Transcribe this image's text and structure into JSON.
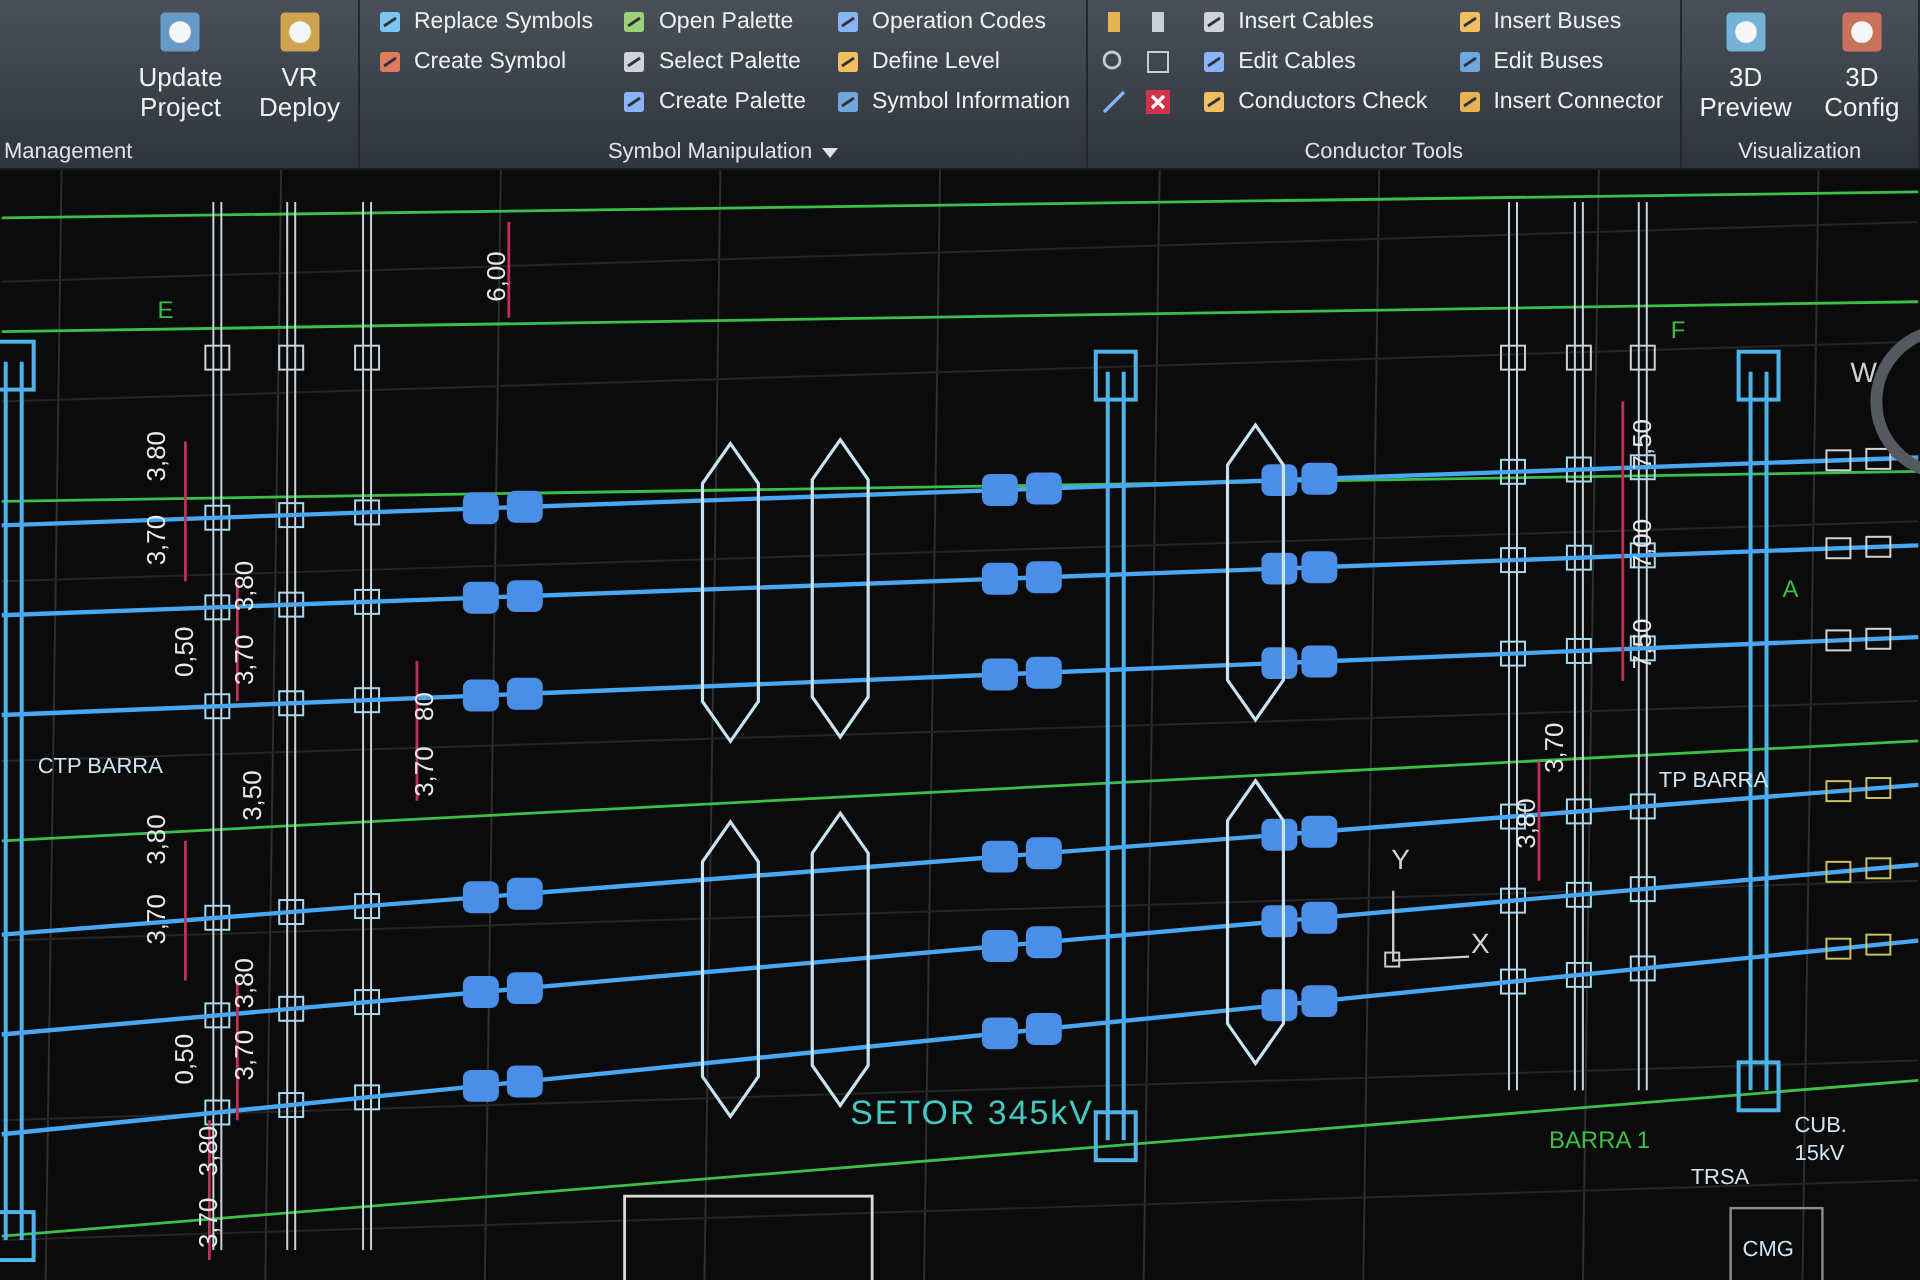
{
  "ribbon": {
    "groups": [
      {
        "kind": "large",
        "label": "Management",
        "items": [
          {
            "label": "Update Project"
          },
          {
            "label": "VR Deploy"
          }
        ]
      },
      {
        "kind": "columns",
        "label": "Symbol Manipulation",
        "dropdown": true,
        "columns": [
          [
            {
              "label": "Replace Symbols"
            },
            {
              "label": "Create Symbol"
            }
          ],
          [
            {
              "label": "Open Palette"
            },
            {
              "label": "Select Palette"
            },
            {
              "label": "Create Palette"
            }
          ],
          [
            {
              "label": "Operation Codes"
            },
            {
              "label": "Define Level"
            },
            {
              "label": "Symbol Information"
            }
          ]
        ]
      },
      {
        "kind": "columns",
        "label": "Conductor Tools",
        "columns": [
          [
            {
              "label": "Insert Cables"
            },
            {
              "label": "Edit Cables"
            },
            {
              "label": "Conductors Check"
            }
          ],
          [
            {
              "label": "Insert Buses"
            },
            {
              "label": "Edit Buses"
            },
            {
              "label": "Insert Connector"
            }
          ]
        ]
      },
      {
        "kind": "large",
        "label": "Visualization",
        "items": [
          {
            "label": "3D Preview"
          },
          {
            "label": "3D Config"
          }
        ]
      }
    ]
  },
  "drawing": {
    "labels": [
      {
        "text": "6,00",
        "kind": "dimension"
      },
      {
        "text": "E",
        "kind": "marker"
      },
      {
        "text": "F",
        "kind": "marker"
      },
      {
        "text": "3,80",
        "kind": "dimension"
      },
      {
        "text": "3,70",
        "kind": "dimension"
      },
      {
        "text": "0,50",
        "kind": "dimension"
      },
      {
        "text": "3,80",
        "kind": "dimension"
      },
      {
        "text": "3,70",
        "kind": "dimension"
      },
      {
        "text": "80",
        "kind": "dimension"
      },
      {
        "text": "3,70",
        "kind": "dimension"
      },
      {
        "text": "3,50",
        "kind": "dimension"
      },
      {
        "text": "CTP BARRA",
        "kind": "tag"
      },
      {
        "text": "3,80",
        "kind": "dimension"
      },
      {
        "text": "3,70",
        "kind": "dimension"
      },
      {
        "text": "0,50",
        "kind": "dimension"
      },
      {
        "text": "3,80",
        "kind": "dimension"
      },
      {
        "text": "3,70",
        "kind": "dimension"
      },
      {
        "text": "3,80",
        "kind": "dimension"
      },
      {
        "text": "3,70",
        "kind": "dimension"
      },
      {
        "text": "SETOR 345kV",
        "kind": "title"
      },
      {
        "text": "7,50",
        "kind": "dimension"
      },
      {
        "text": "7,00",
        "kind": "dimension"
      },
      {
        "text": "7,50",
        "kind": "dimension"
      },
      {
        "text": "TP BARRA",
        "kind": "tag"
      },
      {
        "text": "3,80",
        "kind": "dimension"
      },
      {
        "text": "3,70",
        "kind": "dimension"
      },
      {
        "text": "Y",
        "kind": "axis"
      },
      {
        "text": "X",
        "kind": "axis"
      },
      {
        "text": "A",
        "kind": "marker"
      },
      {
        "text": "W",
        "kind": "axis"
      },
      {
        "text": "BARRA 1",
        "kind": "marker"
      },
      {
        "text": "TRSA",
        "kind": "tag"
      },
      {
        "text": "CUB.",
        "kind": "tag"
      },
      {
        "text": "15kV",
        "kind": "tag"
      },
      {
        "text": "CMG",
        "kind": "tag"
      }
    ]
  }
}
